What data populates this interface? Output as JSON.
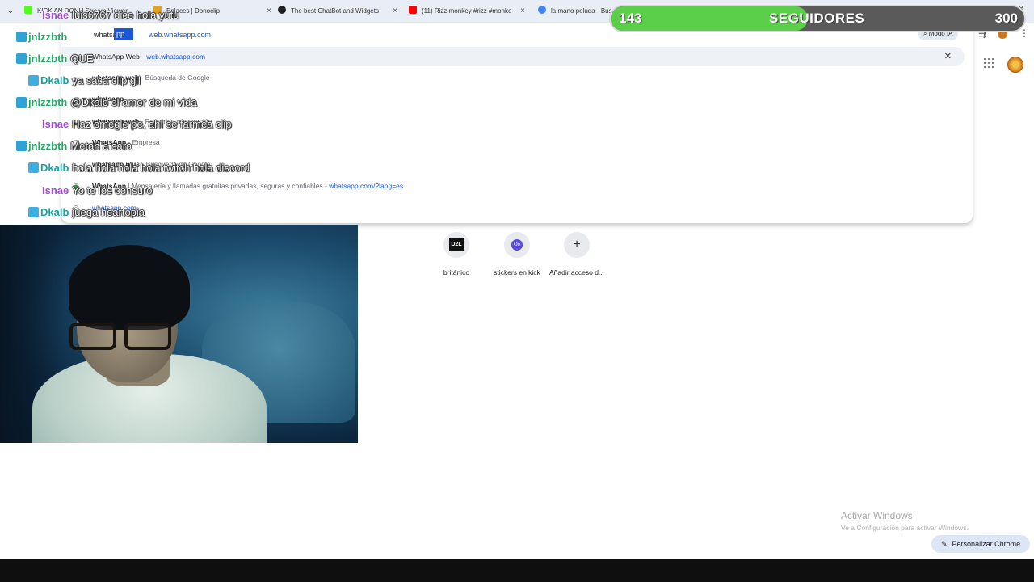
{
  "browser": {
    "tabs": [
      {
        "title": "KICK AN DONU Stream Viewer",
        "favicon_color": "#53fc18"
      },
      {
        "title": "Enlaces | Donoclip",
        "favicon_color": "#e0a020"
      },
      {
        "title": "The best ChatBot and Widgets",
        "favicon_color": "#222222"
      },
      {
        "title": "(11) Rizz monkey #rizz #monke",
        "favicon_color": "#ff0000"
      },
      {
        "title": "la mano peluda - Bus",
        "favicon_color": "#4285f4"
      }
    ],
    "tab_close": "×",
    "window_controls": {
      "minimize": "—",
      "maximize": "❐",
      "close": "✕"
    }
  },
  "omnibox": {
    "typed": "whatsa",
    "selected_completion": "pp Web",
    "url_hint": "web.whatsapp.com",
    "mode_ia_label": "Modo IA",
    "suggestions": [
      {
        "icon": "globe-icon",
        "bold": "WhatsApp Web",
        "sub": "",
        "link": "web.whatsapp.com",
        "highlighted": true,
        "close": "✕"
      },
      {
        "icon": "search-icon",
        "bold": "whatsapp web",
        "sub": "- Búsqueda de Google",
        "link": "",
        "highlighted": false
      },
      {
        "icon": "search-icon",
        "bold": "whatsapp",
        "sub": "",
        "link": "",
        "highlighted": false
      },
      {
        "icon": "search-icon",
        "bold": "whatsapp web",
        "sub": "- Recorrido navegación",
        "link": "",
        "highlighted": false
      },
      {
        "icon": "app-icon",
        "bold": "WhatsApp",
        "sub": "- Empresa",
        "link": "",
        "highlighted": false
      },
      {
        "icon": "search-icon",
        "bold": "whatsapp plus",
        "sub": "- Búsqueda de Google",
        "link": "",
        "highlighted": false
      },
      {
        "icon": "whatsapp-icon",
        "bold": "WhatsApp",
        "sub": "| Mensajería y llamadas gratuitas privadas, seguras y confiables -",
        "link": "whatsapp.com/?lang=es",
        "highlighted": false
      },
      {
        "icon": "globe-icon",
        "bold": "whatsapp.com",
        "sub": "",
        "link": "",
        "highlighted": false
      }
    ]
  },
  "followers_goal": {
    "current": "143",
    "label": "SEGUIDORES",
    "goal": "300",
    "progress_fraction": 0.477,
    "fill_color": "#5ccf4a"
  },
  "chat": [
    {
      "user": "Isnae",
      "message": "luis6767 dice hola yutu",
      "user_color": "#a64ddb",
      "badge": ""
    },
    {
      "user": "jnlzzbth",
      "message": "",
      "user_color": "#27a867",
      "badge": "gem-badge"
    },
    {
      "user": "jnlzzbth",
      "message": "QUE",
      "user_color": "#27a867",
      "badge": "gem-badge"
    },
    {
      "user": "Dkalb",
      "message": "ya saca clip gil",
      "user_color": "#18a4a4",
      "badge": "sword-badge"
    },
    {
      "user": "jnlzzbth",
      "message": "@Dkalb el amor de mi vida",
      "user_color": "#27a867",
      "badge": "gem-badge"
    },
    {
      "user": "Isnae",
      "message": "Haz omegle pe, ahí se farmea clip",
      "user_color": "#a64ddb",
      "badge": ""
    },
    {
      "user": "jnlzzbth",
      "message": "Metan a sara",
      "user_color": "#27a867",
      "badge": "gem-badge"
    },
    {
      "user": "Dkalb",
      "message": "hola hola hola hola twitch hola discord",
      "user_color": "#18a4a4",
      "badge": "sword-badge"
    },
    {
      "user": "Isnae",
      "message": "Yo te los censuro",
      "user_color": "#a64ddb",
      "badge": ""
    },
    {
      "user": "Dkalb",
      "message": "juega heartopia",
      "user_color": "#18a4a4",
      "badge": "sword-badge"
    }
  ],
  "shortcuts": [
    {
      "label": "británico",
      "icon": "d2l-icon",
      "glyph": "D2L"
    },
    {
      "label": "stickers en kick",
      "icon": "oo-icon",
      "glyph": "Oo"
    },
    {
      "label": "Añadir acceso d...",
      "icon": "plus-icon",
      "glyph": "+"
    }
  ],
  "windows_watermark": {
    "title": "Activar Windows",
    "subtitle": "Ve a Configuración para activar Windows."
  },
  "customize_button": {
    "label": "Personalizar Chrome",
    "icon": "pencil-icon"
  }
}
